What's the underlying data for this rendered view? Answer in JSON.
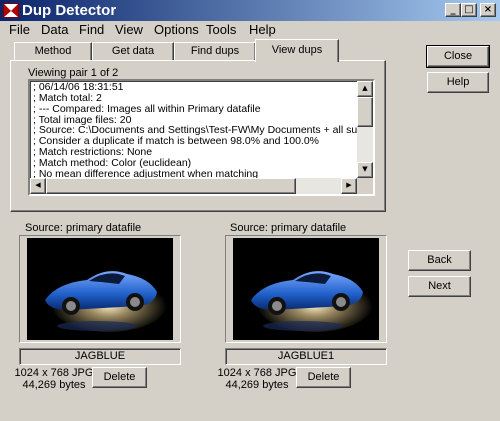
{
  "window": {
    "title": "Dup Detector",
    "controls": {
      "minimize": "_",
      "maximize": "□",
      "close": "×"
    }
  },
  "menu": [
    "File",
    "Data",
    "Find",
    "View",
    "Options",
    "Tools",
    "Help"
  ],
  "tabs": [
    {
      "label": "Method",
      "active": false
    },
    {
      "label": "Get data",
      "active": false
    },
    {
      "label": "Find dups",
      "active": false
    },
    {
      "label": "View dups",
      "active": true
    }
  ],
  "viewing": "Viewing pair 1 of 2",
  "log": [
    "; 06/14/06 18:31:51",
    "; Match total: 2",
    "; --- Compared: Images all within Primary datafile",
    "; Total image files: 20",
    "; Source: C:\\Documents and Settings\\Test-FW\\My Documents + all subfolders",
    "; Consider a duplicate if match is between 98.0% and 100.0%",
    "; Match restrictions: None",
    "; Match method: Color (euclidean)",
    "; No mean difference adjustment when matching"
  ],
  "scroll_icons": {
    "up": "▲",
    "down": "▼",
    "left": "◀",
    "right": "▶"
  },
  "buttons": {
    "close": "Close",
    "help": "Help",
    "back": "Back",
    "next": "Next"
  },
  "left_image": {
    "source_label": "Source: primary datafile",
    "name": "JAGBLUE",
    "dimensions": "1024 x 768 JPG",
    "size": "44,269 bytes",
    "delete_label": "Delete"
  },
  "right_image": {
    "source_label": "Source: primary datafile",
    "name": "JAGBLUE1",
    "dimensions": "1024 x 768 JPG",
    "size": "44,269 bytes",
    "delete_label": "Delete"
  },
  "colors": {
    "titlebar_start": "#0a246a",
    "titlebar_end": "#a6caf0",
    "face": "#d4d0c8",
    "car": "#1f5fc8"
  }
}
